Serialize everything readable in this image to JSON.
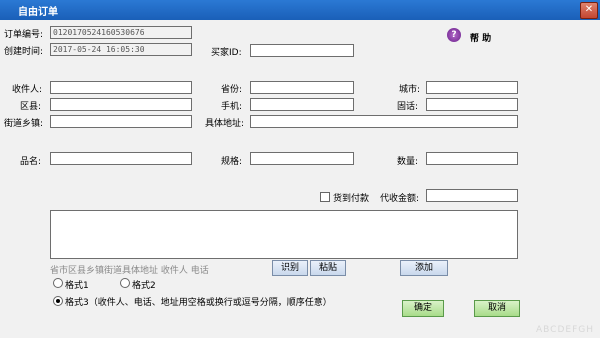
{
  "window": {
    "title": "自由订单",
    "close_symbol": "✕"
  },
  "help": {
    "icon": "help-icon",
    "label": "帮 助"
  },
  "order": {
    "number_label": "订单编号:",
    "number_value": "0120170524160530676",
    "time_label": "创建时间:",
    "time_value": "2017-05-24 16:05:30",
    "buyer_label": "买家ID:",
    "buyer_value": ""
  },
  "recipient": {
    "name_label": "收件人:",
    "name_value": "",
    "province_label": "省份:",
    "province_value": "",
    "city_label": "城市:",
    "city_value": "",
    "district_label": "区县:",
    "district_value": "",
    "mobile_label": "手机:",
    "mobile_value": "",
    "phone_label": "固话:",
    "phone_value": "",
    "street_label": "街道乡镇:",
    "street_value": "",
    "address_label": "具体地址:",
    "address_value": ""
  },
  "product": {
    "name_label": "品名:",
    "name_value": "",
    "spec_label": "规格:",
    "spec_value": "",
    "qty_label": "数量:",
    "qty_value": ""
  },
  "payment": {
    "cod_label": "货到付款",
    "cod_checked": false,
    "amount_label": "代收金额:",
    "amount_value": ""
  },
  "paste": {
    "hint": "省市区县乡镇街道具体地址 收件人 电话",
    "recognize_button": "识别",
    "paste_button": "粘贴",
    "add_button": "添加"
  },
  "formats": {
    "format1": "格式1",
    "format2": "格式2",
    "format3": "格式3（收件人、电话、地址用空格或换行或逗号分隔，顺序任意）",
    "selected": "format3"
  },
  "actions": {
    "confirm": "确定",
    "cancel": "取消"
  },
  "watermark": "ABCDEFGH"
}
